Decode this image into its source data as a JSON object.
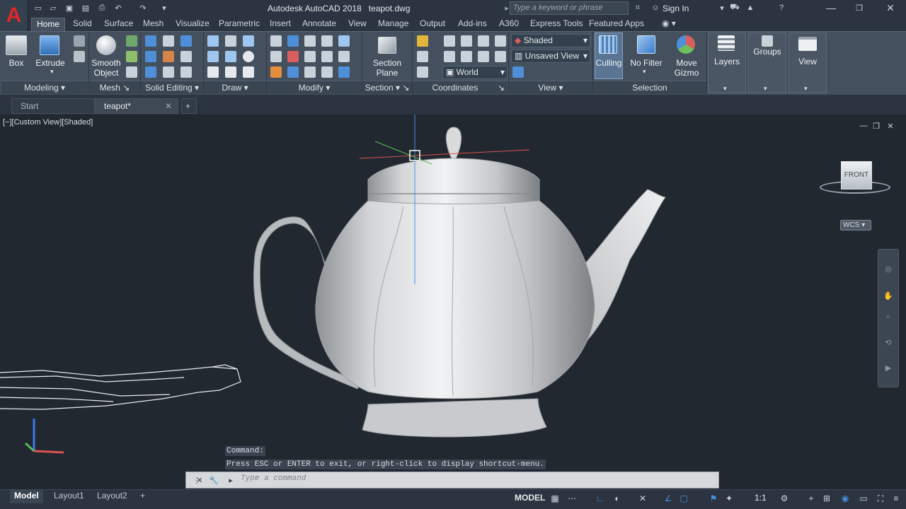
{
  "app": {
    "logo": "A",
    "title": "Autodesk AutoCAD 2018",
    "doc": "teapot.dwg"
  },
  "search": {
    "placeholder": "Type a keyword or phrase"
  },
  "account": {
    "sign_in": "Sign In"
  },
  "ribbon_tabs": [
    "Home",
    "Solid",
    "Surface",
    "Mesh",
    "Visualize",
    "Parametric",
    "Insert",
    "Annotate",
    "View",
    "Manage",
    "Output",
    "Add-ins",
    "A360",
    "Express Tools",
    "Featured Apps"
  ],
  "panels": {
    "modeling": "Modeling",
    "mesh": "Mesh",
    "solid_editing": "Solid Editing",
    "draw": "Draw",
    "modify": "Modify",
    "section": "Section",
    "coordinates": "Coordinates",
    "view": "View",
    "selection": "Selection"
  },
  "buttons": {
    "box": "Box",
    "extrude": "Extrude",
    "smooth1": "Smooth",
    "smooth2": "Object",
    "section1": "Section",
    "section2": "Plane",
    "culling": "Culling",
    "nofilter": "No Filter",
    "move1": "Move",
    "move2": "Gizmo",
    "layers": "Layers",
    "groups": "Groups",
    "view": "View"
  },
  "dropdowns": {
    "visual_style": "Shaded",
    "named_view": "Unsaved View",
    "ucs": "World"
  },
  "doc_tabs": [
    "Start",
    "teapot*"
  ],
  "viewport": {
    "label": "[−][Custom View][Shaded]",
    "viewcube_face": "FRONT",
    "wcs": "WCS"
  },
  "command": {
    "history1": "Command:",
    "history2": "Press ESC or ENTER to exit, or right-click to display shortcut-menu.",
    "placeholder": "Type a command"
  },
  "layout_tabs": [
    "Model",
    "Layout1",
    "Layout2"
  ],
  "status": {
    "model": "MODEL",
    "scale": "1:1"
  },
  "colors": {
    "accent": "#3a8ee6",
    "logo_red": "#e0272a",
    "viewport_bg": "#212830",
    "ribbon_bg": "#44505e"
  }
}
